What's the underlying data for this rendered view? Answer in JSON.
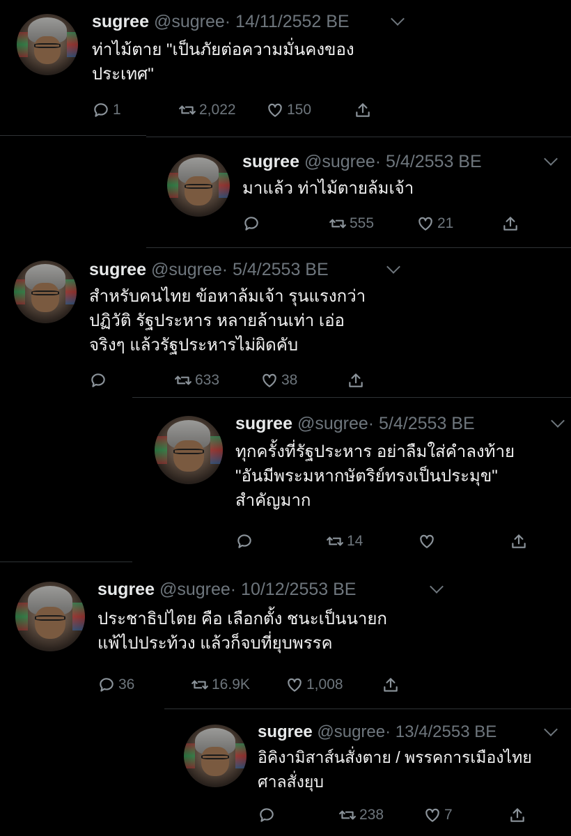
{
  "tweets": [
    {
      "name": "sugree",
      "handle": "@sugree",
      "sep": "·",
      "date": "14/11/2552 BE",
      "text": "ท่าไม้ตาย \"เป็นภัยต่อความมั่นคงของ\nประเทศ\"",
      "replies": "1",
      "retweets": "2,022",
      "likes": "150"
    },
    {
      "name": "sugree",
      "handle": "@sugree",
      "sep": "·",
      "date": "5/4/2553 BE",
      "text": "มาแล้ว ท่าไม้ตายล้มเจ้า",
      "replies": "",
      "retweets": "555",
      "likes": "21"
    },
    {
      "name": "sugree",
      "handle": "@sugree",
      "sep": "·",
      "date": "5/4/2553 BE",
      "text": "สำหรับคนไทย ข้อหาล้มเจ้า รุนแรงกว่า\nปฏิวัติ รัฐประหาร หลายล้านเท่า เอ่อ\nจริงๆ แล้วรัฐประหารไม่ผิดคับ",
      "replies": "",
      "retweets": "633",
      "likes": "38"
    },
    {
      "name": "sugree",
      "handle": "@sugree",
      "sep": "·",
      "date": "5/4/2553 BE",
      "text": "ทุกครั้งที่รัฐประหาร อย่าลืมใส่คำลงท้าย\n\"อันมีพระมหากษัตริย์ทรงเป็นประมุข\"\nสำคัญมาก",
      "replies": "",
      "retweets": "14",
      "likes": ""
    },
    {
      "name": "sugree",
      "handle": "@sugree",
      "sep": "·",
      "date": "10/12/2553 BE",
      "text": "ประชาธิปไตย คือ เลือกตั้ง ชนะเป็นนายก\nแพ้ไปประท้วง แล้วก็จบที่ยุบพรรค",
      "replies": "36",
      "retweets": "16.9K",
      "likes": "1,008"
    },
    {
      "name": "sugree",
      "handle": "@sugree",
      "sep": "·",
      "date": "13/4/2553 BE",
      "text": "อิคิงามิสาส์นสั่งตาย / พรรคการเมืองไทย\nศาลสั่งยุบ",
      "replies": "",
      "retweets": "238",
      "likes": "7"
    }
  ],
  "icons": {
    "reply": "reply-icon",
    "retweet": "retweet-icon",
    "like": "heart-icon",
    "share": "share-icon",
    "more": "chevron-down-icon"
  },
  "colors": {
    "background": "#000000",
    "muted": "#6e767d",
    "text": "#e7e9ea"
  }
}
